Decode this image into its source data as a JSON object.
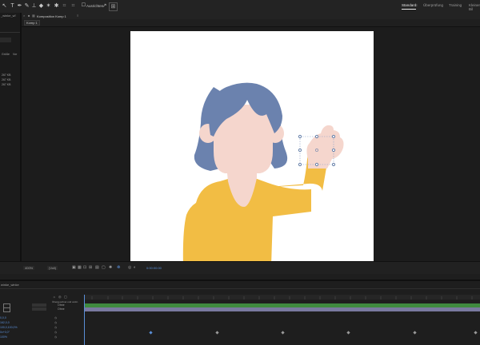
{
  "toolbar": {
    "ausrichten_label": "Ausrichten",
    "workspaces": [
      {
        "label": "Standard",
        "active": true
      },
      {
        "label": "Überprüfung",
        "active": false
      },
      {
        "label": "Training",
        "active": false
      },
      {
        "label": "Kleiner Bil",
        "active": false
      }
    ]
  },
  "left_panel": {
    "title": "_winke_w",
    "col_headers": [
      "Größe",
      "Vor"
    ],
    "files": [
      {
        "size": "267 KB"
      },
      {
        "size": "267 KB"
      },
      {
        "size": "267 KB"
      }
    ]
  },
  "composition": {
    "tab_label": "Komposition Komp 1",
    "sub_tab_label": "Komp 1"
  },
  "viewer": {
    "zoom": "400%",
    "resolution": "(Voll)",
    "timecode": "0:00:00:00"
  },
  "timeline": {
    "panel_title": "winke_winke",
    "parent_header": "Übergeordnet und verkn",
    "layers": [
      {
        "parent": "Ohne"
      },
      {
        "parent": "Ohne"
      }
    ],
    "properties": [
      {
        "value": "0,0,0"
      },
      {
        "value": "162,0,0"
      },
      {
        "value": "100,0,100,0%"
      },
      {
        "value": "0x+0,0°"
      },
      {
        "value": "100%"
      }
    ]
  },
  "colors": {
    "hair": "#6b82ae",
    "skin": "#f5d6cd",
    "shirt": "#f2bd44",
    "canvas": "#ffffff",
    "track_bar": "#7a7aa0",
    "green_bar": "#3f8a3f",
    "time_indicator": "#5a8fd8"
  }
}
